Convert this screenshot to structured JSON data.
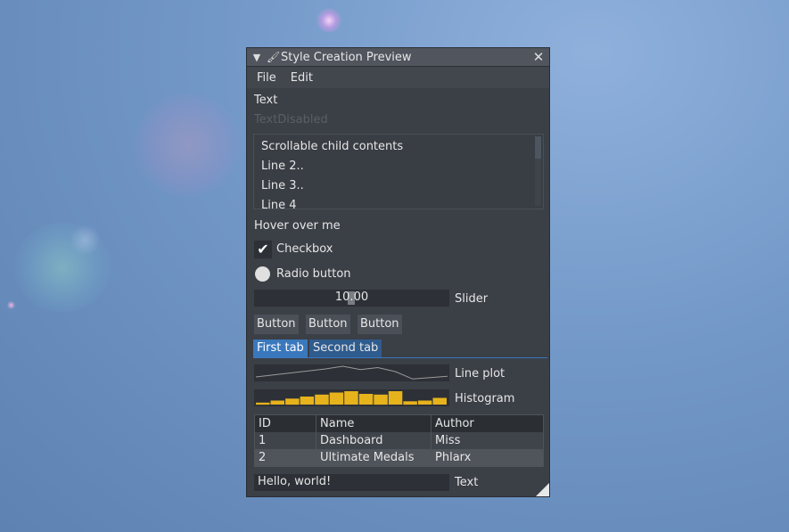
{
  "window": {
    "title": "Style Creation Preview",
    "icons": {
      "collapse": "triangle-down-icon",
      "title": "paintbrush-icon",
      "close": "close-icon"
    }
  },
  "menu": {
    "file": "File",
    "edit": "Edit"
  },
  "text_label": "Text",
  "text_disabled": "TextDisabled",
  "scroll_child": {
    "lines": [
      "Scrollable child contents",
      "Line 2..",
      "Line 3..",
      "Line 4"
    ]
  },
  "hover_text": "Hover over me",
  "checkbox": {
    "label": "Checkbox",
    "checked": true
  },
  "radio": {
    "label": "Radio button"
  },
  "slider": {
    "value": "10.00",
    "label": "Slider"
  },
  "buttons": [
    "Button",
    "Button",
    "Button"
  ],
  "tabs": [
    {
      "label": "First tab",
      "active": true
    },
    {
      "label": "Second tab",
      "active": false
    }
  ],
  "line_plot": {
    "label": "Line plot",
    "values": [
      0.2,
      0.35,
      0.5,
      0.65,
      0.8,
      1.0,
      0.75,
      0.9,
      0.6,
      0.05,
      0.15,
      0.25
    ]
  },
  "histogram": {
    "label": "Histogram",
    "values": [
      0.15,
      0.3,
      0.45,
      0.6,
      0.75,
      0.9,
      1.0,
      0.8,
      0.75,
      1.0,
      0.25,
      0.3,
      0.5
    ],
    "color": "#e6b31c"
  },
  "table": {
    "headers": [
      "ID",
      "Name",
      "Author"
    ],
    "rows": [
      [
        "1",
        "Dashboard",
        "Miss"
      ],
      [
        "2",
        "Ultimate Medals",
        "Phlarx"
      ]
    ]
  },
  "input": {
    "value": "Hello, world!",
    "label": "Text"
  },
  "colors": {
    "accent": "#3a78bd",
    "window_bg": "#3b3f46",
    "title_bg": "#50555e"
  }
}
